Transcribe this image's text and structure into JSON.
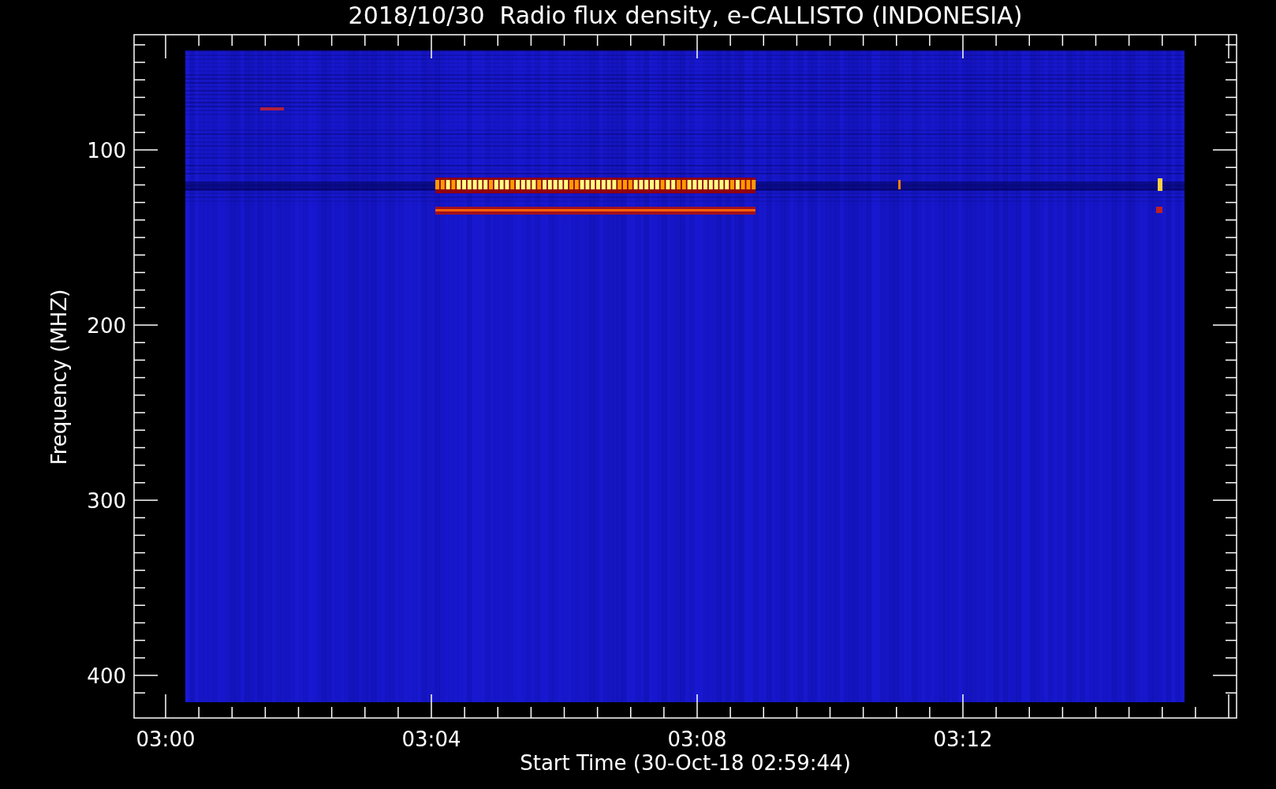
{
  "title": "2018/10/30  Radio flux density, e-CALLISTO (INDONESIA)",
  "y_axis": {
    "label": "Frequency (MHZ)",
    "ticks": [
      "100",
      "200",
      "300",
      "400"
    ]
  },
  "x_axis": {
    "label": "Start Time (30-Oct-18 02:59:44)",
    "ticks": [
      "03:00",
      "03:04",
      "03:08",
      "03:12"
    ]
  }
}
